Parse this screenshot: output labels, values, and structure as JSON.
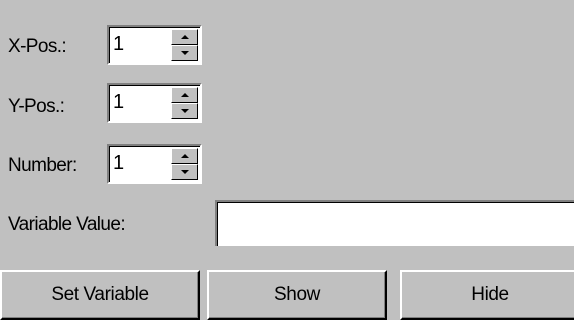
{
  "fields": {
    "x_pos": {
      "label": "X-Pos.:",
      "value": "1"
    },
    "y_pos": {
      "label": "Y-Pos.:",
      "value": "1"
    },
    "number": {
      "label": "Number:",
      "value": "1"
    }
  },
  "variable_value": {
    "label": "Variable Value:",
    "value": ""
  },
  "buttons": {
    "set_variable": "Set Variable",
    "show": "Show",
    "hide": "Hide"
  }
}
